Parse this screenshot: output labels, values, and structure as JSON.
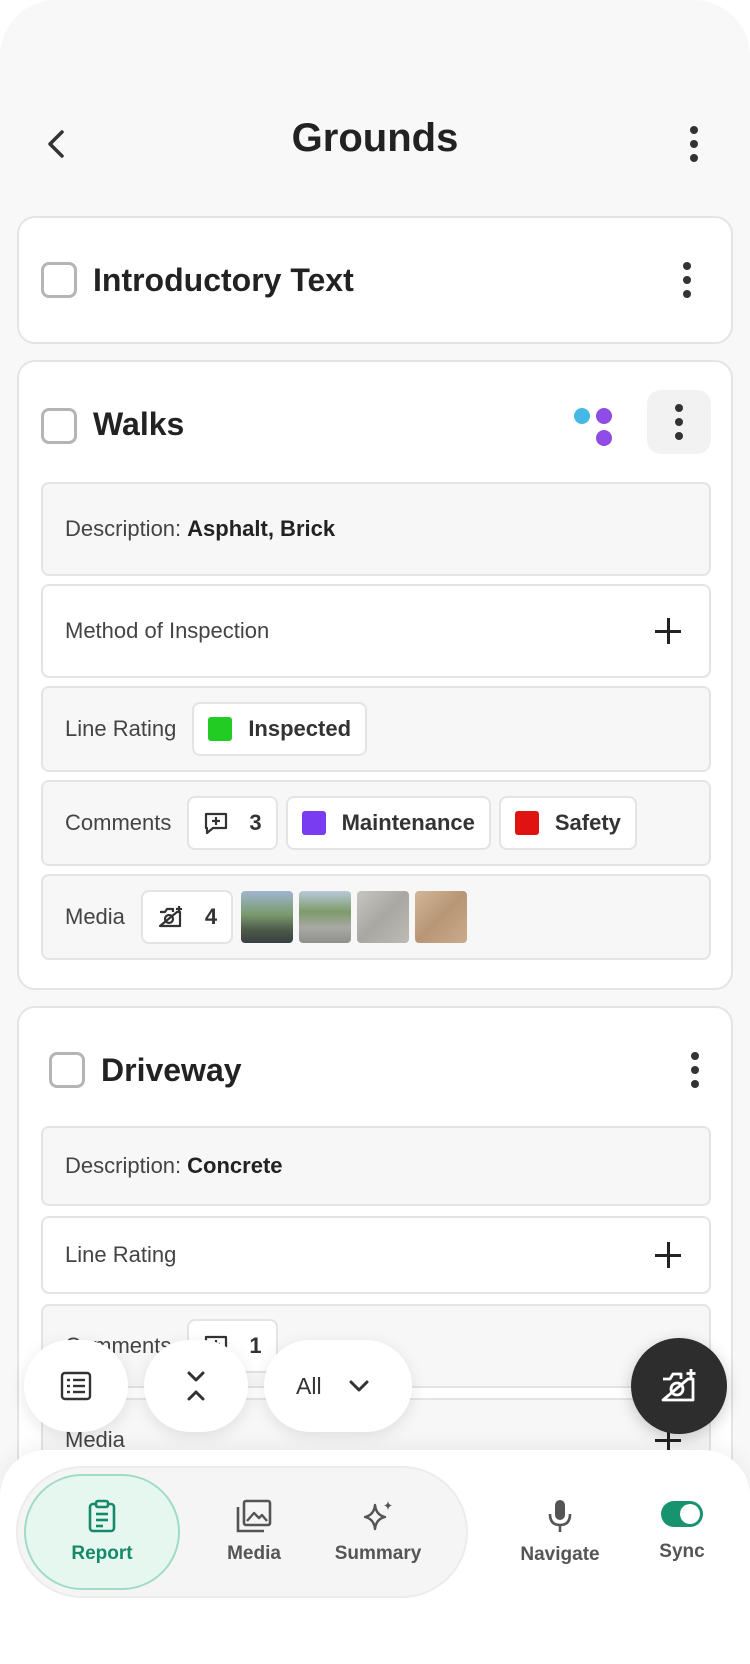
{
  "header": {
    "title": "Grounds"
  },
  "cards": [
    {
      "title": "Introductory Text"
    },
    {
      "title": "Walks",
      "status_dots": [
        "#45b9e4",
        "#8f4ce6",
        "#8f4ce6"
      ],
      "description_label": "Description:",
      "description_value": "Asphalt, Brick",
      "method_label": "Method of Inspection",
      "line_rating_label": "Line Rating",
      "line_rating_value": "Inspected",
      "line_rating_color": "#22cc22",
      "comments_label": "Comments",
      "comments_count": "3",
      "tags": [
        {
          "label": "Maintenance",
          "color": "#7a3cf0"
        },
        {
          "label": "Safety",
          "color": "#e11212"
        }
      ],
      "media_label": "Media",
      "media_count": "4"
    },
    {
      "title": "Driveway",
      "description_label": "Description:",
      "description_value": "Concrete",
      "line_rating_label": "Line Rating",
      "comments_label": "Comments",
      "comments_count": "1",
      "media_label": "Media"
    }
  ],
  "filter": {
    "selected": "All"
  },
  "nav": {
    "items": [
      {
        "label": "Report",
        "icon": "clipboard-icon",
        "active": true
      },
      {
        "label": "Media",
        "icon": "gallery-icon"
      },
      {
        "label": "Summary",
        "icon": "sparkle-icon"
      },
      {
        "label": "Navigate",
        "icon": "microphone-icon"
      },
      {
        "label": "Sync",
        "icon": "toggle-icon"
      }
    ]
  },
  "colors": {
    "accent": "#18936f",
    "accent_bg": "#e6f7f0"
  }
}
